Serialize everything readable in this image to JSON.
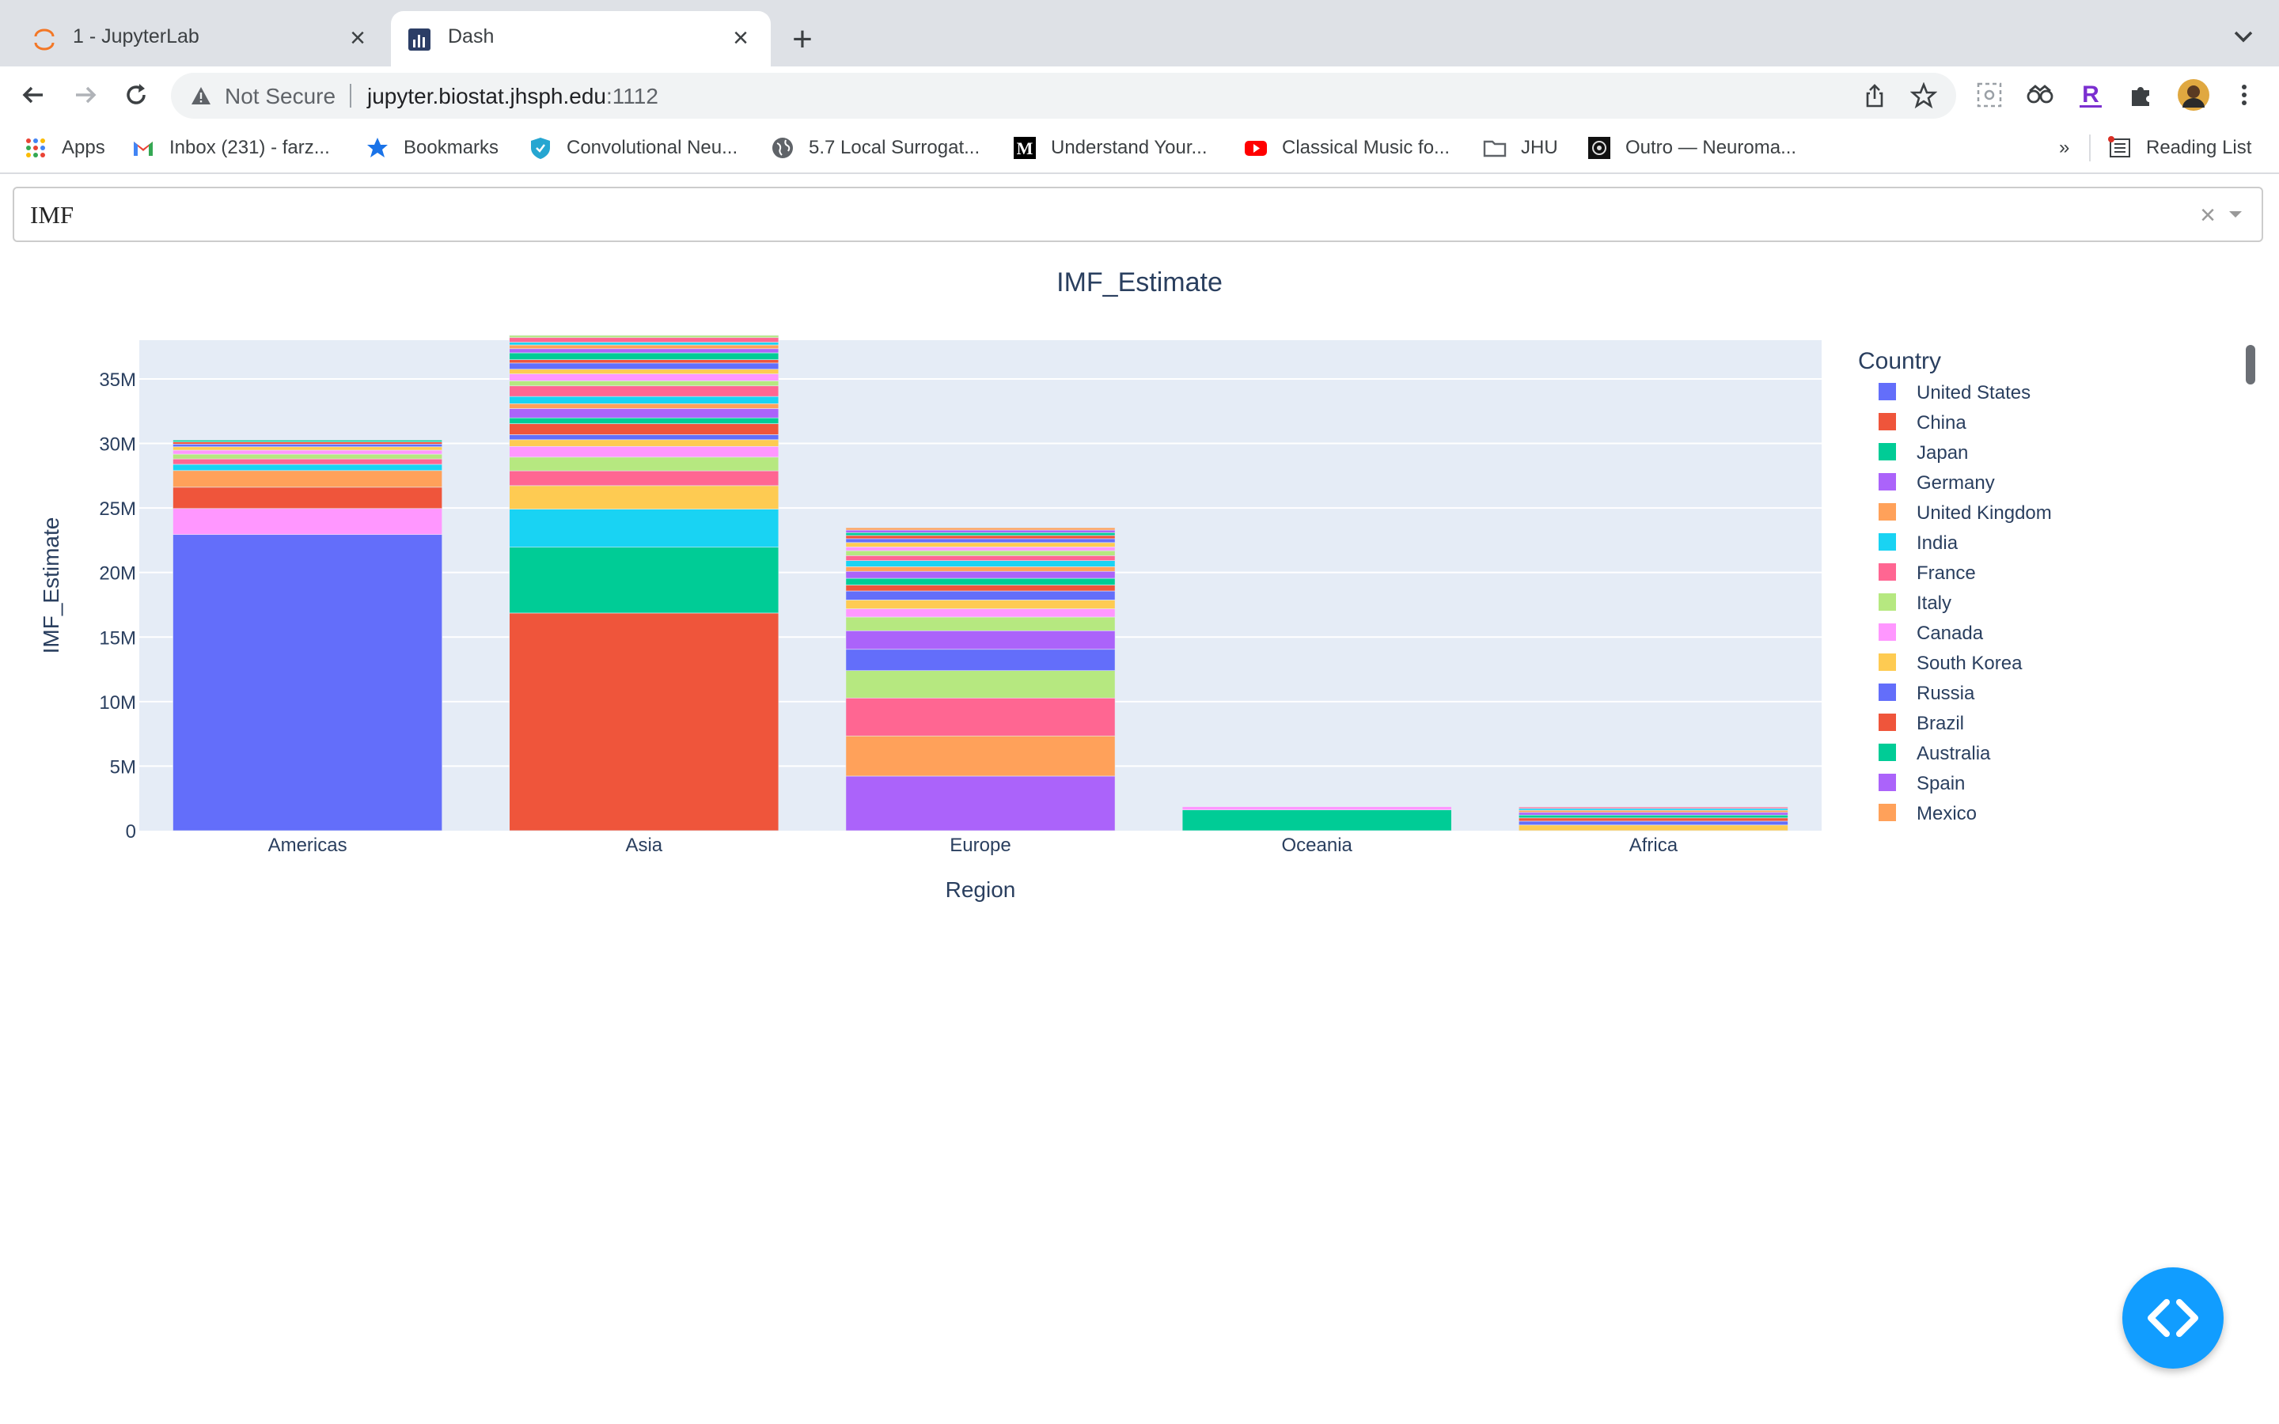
{
  "browser": {
    "tabs": [
      {
        "title": "1 - JupyterLab",
        "active": false,
        "icon": "jupyter-icon"
      },
      {
        "title": "Dash",
        "active": true,
        "icon": "dash-icon"
      }
    ],
    "security_label": "Not Secure",
    "url_host": "jupyter.biostat.jhsph.edu",
    "url_port": ":1112",
    "bookmarks": [
      {
        "label": "Apps",
        "icon": "apps-grid-icon"
      },
      {
        "label": "Inbox (231) - farz...",
        "icon": "gmail-icon"
      },
      {
        "label": "Bookmarks",
        "icon": "star-icon"
      },
      {
        "label": "Convolutional Neu...",
        "icon": "shield-icon"
      },
      {
        "label": "5.7 Local Surrogat...",
        "icon": "globe-icon"
      },
      {
        "label": "Understand Your...",
        "icon": "medium-icon"
      },
      {
        "label": "Classical Music fo...",
        "icon": "youtube-icon"
      },
      {
        "label": "JHU",
        "icon": "folder-icon"
      },
      {
        "label": "Outro — Neuroma...",
        "icon": "site-icon"
      }
    ],
    "overflow": "»",
    "reading_list": "Reading List"
  },
  "app": {
    "dropdown_value": "IMF",
    "clear_symbol": "×"
  },
  "chart_data": {
    "type": "bar",
    "stacked": true,
    "title": "IMF_Estimate",
    "xlabel": "Region",
    "ylabel": "IMF_Estimate",
    "categories": [
      "Americas",
      "Asia",
      "Europe",
      "Oceania",
      "Africa"
    ],
    "ylim": [
      0,
      38000000
    ],
    "yticks": [
      0,
      5000000,
      10000000,
      15000000,
      20000000,
      25000000,
      30000000,
      35000000
    ],
    "ytick_labels": [
      "0",
      "5M",
      "10M",
      "15M",
      "20M",
      "25M",
      "30M",
      "35M"
    ],
    "grid": true,
    "legend_title": "Country",
    "legend_placement": "right",
    "series": [
      {
        "name": "United States",
        "color": "#636efa",
        "region": "Americas",
        "value": 22940000
      },
      {
        "name": "China",
        "color": "#ef553b",
        "region": "Asia",
        "value": 16860000
      },
      {
        "name": "Japan",
        "color": "#00cc96",
        "region": "Asia",
        "value": 5100000
      },
      {
        "name": "Germany",
        "color": "#ab63fa",
        "region": "Europe",
        "value": 4230000
      },
      {
        "name": "United Kingdom",
        "color": "#ffa15a",
        "region": "Europe",
        "value": 3110000
      },
      {
        "name": "India",
        "color": "#19d3f3",
        "region": "Asia",
        "value": 2950000
      },
      {
        "name": "France",
        "color": "#ff6692",
        "region": "Europe",
        "value": 2940000
      },
      {
        "name": "Italy",
        "color": "#b6e880",
        "region": "Europe",
        "value": 2120000
      },
      {
        "name": "Canada",
        "color": "#ff97ff",
        "region": "Americas",
        "value": 2020000
      },
      {
        "name": "South Korea",
        "color": "#fecb52",
        "region": "Asia",
        "value": 1820000
      },
      {
        "name": "Russia",
        "color": "#636efa",
        "region": "Europe",
        "value": 1650000
      },
      {
        "name": "Brazil",
        "color": "#ef553b",
        "region": "Americas",
        "value": 1650000
      },
      {
        "name": "Australia",
        "color": "#00cc96",
        "region": "Oceania",
        "value": 1610000
      },
      {
        "name": "Spain",
        "color": "#ab63fa",
        "region": "Europe",
        "value": 1440000
      },
      {
        "name": "Mexico",
        "color": "#ffa15a",
        "region": "Americas",
        "value": 1290000
      }
    ],
    "remaining_stacks": {
      "Americas": [
        480000,
        420000,
        370000,
        310000,
        260000,
        210000,
        170000,
        140000
      ],
      "Asia": [
        1150000,
        1060000,
        830000,
        520000,
        390000,
        850000,
        450000,
        720000,
        380000,
        560000,
        820000,
        390000,
        540000,
        360000,
        480000,
        260000,
        530000,
        320000,
        290000,
        210000,
        360000,
        170000
      ],
      "Europe": [
        1060000,
        640000,
        680000,
        700000,
        460000,
        520000,
        540000,
        360000,
        470000,
        390000,
        380000,
        290000,
        340000,
        300000,
        250000,
        220000,
        200000,
        180000
      ],
      "Oceania": [
        250000
      ],
      "Africa": [
        440000,
        300000,
        250000,
        220000,
        210000,
        160000,
        140000,
        110000
      ]
    }
  }
}
